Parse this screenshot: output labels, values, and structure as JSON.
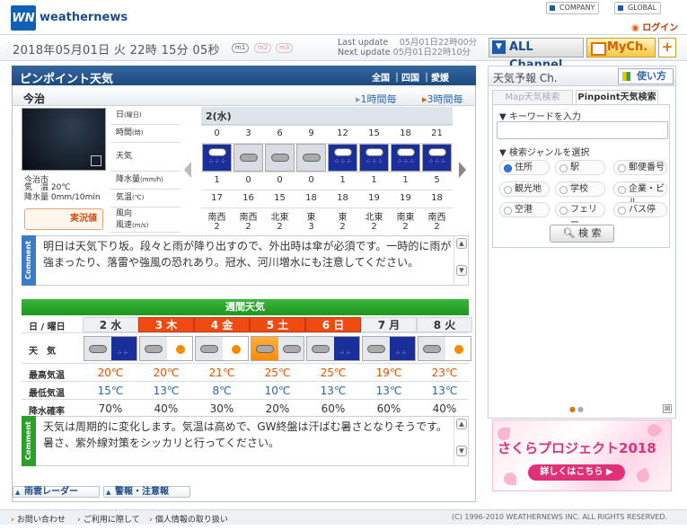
{
  "header": {
    "logo_text": "weathernews",
    "links": [
      "COMPANY",
      "GLOBAL"
    ],
    "login": "ログイン"
  },
  "datebar": {
    "clock": "2018年05月01日 火 22時 15分 05秒",
    "pills": [
      "m1",
      "m2",
      "m3"
    ],
    "last_update_label": "Last update",
    "last_update_value": "05月01日22時00分",
    "next_update_label": "Next update",
    "next_update_value": "05月01日22時10分",
    "all_channel": "ALL Channel",
    "mych": "MyCh.",
    "plus": "+"
  },
  "pinpoint": {
    "title": "ピンポイント天気",
    "breadcrumb": [
      "全国",
      "四国",
      "愛媛"
    ],
    "city": "今治",
    "tab_1h": "1時間毎",
    "tab_3h": "3時間毎",
    "camera": {
      "city": "今治市",
      "temp_label": "気　温",
      "temp_value": "20℃",
      "rain_label": "降水量",
      "rain_value": "0mm/10min",
      "live_label": "実況値"
    },
    "row_labels": {
      "date": "日",
      "date_sub": "(曜日)",
      "time": "時間",
      "time_sub": "(時)",
      "weather": "天気",
      "rain": "降水量",
      "rain_sub": "(mm/h)",
      "temp": "気温",
      "temp_sub": "(℃)",
      "wind": "風向",
      "wind_sub": "風速",
      "wind_unit": "(m/s)"
    },
    "date_header": "2(水)",
    "hours": [
      "0",
      "3",
      "6",
      "9",
      "12",
      "15",
      "18",
      "21"
    ],
    "weather": [
      "rain",
      "cloud",
      "cloud",
      "cloud",
      "rain",
      "rain",
      "rain",
      "rain"
    ],
    "rain": [
      "1",
      "0",
      "0",
      "0",
      "1",
      "1",
      "1",
      "5"
    ],
    "temp": [
      "17",
      "16",
      "15",
      "18",
      "18",
      "19",
      "19",
      "18"
    ],
    "wind_dir": [
      "南西",
      "南西",
      "北東",
      "東",
      "東",
      "北東",
      "南東",
      "南西"
    ],
    "wind_speed": [
      "2",
      "2",
      "2",
      "3",
      "2",
      "2",
      "2",
      "2"
    ],
    "comment_label": "Comment",
    "comment": "明日は天気下り坂。段々と雨が降り出すので、外出時は傘が必須です。一時的に雨が強まったり、落雷や強風の恐れあり。冠水、河川増水にも注意してください。"
  },
  "weekly": {
    "title": "週間天気",
    "labels": {
      "day": "日 / 曜日",
      "weather": "天　気",
      "max": "最高気温",
      "min": "最低気温",
      "pop": "降水確率"
    },
    "days": [
      {
        "day": "2 水",
        "holiday": false,
        "max": "20℃",
        "min": "15℃",
        "pop": "70%",
        "icon": "cloud-rain"
      },
      {
        "day": "3 木",
        "holiday": true,
        "max": "20℃",
        "min": "13℃",
        "pop": "40%",
        "icon": "cloud-sun"
      },
      {
        "day": "4 金",
        "holiday": true,
        "max": "21℃",
        "min": "8℃",
        "pop": "30%",
        "icon": "cloud-sun"
      },
      {
        "day": "5 土",
        "holiday": true,
        "max": "25℃",
        "min": "10℃",
        "pop": "20%",
        "icon": "sun-cloud"
      },
      {
        "day": "6 日",
        "holiday": true,
        "max": "25℃",
        "min": "13℃",
        "pop": "60%",
        "icon": "cloud-rain"
      },
      {
        "day": "7 月",
        "holiday": false,
        "max": "19℃",
        "min": "13℃",
        "pop": "60%",
        "icon": "cloud-rain"
      },
      {
        "day": "8 火",
        "holiday": false,
        "max": "23℃",
        "min": "13℃",
        "pop": "40%",
        "icon": "cloud-sun"
      }
    ],
    "comment_label": "Comment",
    "comment": "天気は周期的に変化します。気温は高めで、GW終盤は汗ばむ暑さとなりそうです。暑さ、紫外線対策をシッカリと行ってください。"
  },
  "bottom_links": [
    "雨雲レーダー",
    "警報・注意報"
  ],
  "footer": {
    "links": [
      "お問い合わせ",
      "ご利用に際して",
      "個人情報の取り扱い"
    ],
    "copyright": "(C) 1996-2010 WEATHERNEWS INC. ALL RIGHTS RESERVED."
  },
  "sidebar": {
    "title": "天気予報 Ch.",
    "howto": "使い方",
    "tabs": [
      "Map天気検索",
      "Pinpoint天気検索"
    ],
    "keyword_label": "▼ キーワードを入力",
    "genre_label": "▼ 検索ジャンルを選択",
    "genres": [
      "住所",
      "駅",
      "郵便番号",
      "観光地",
      "学校",
      "企業・ビル",
      "空港",
      "フェリー",
      "バス停"
    ],
    "search_button": "検 索",
    "banner_title": "さくらプロジェクト2018",
    "banner_button": "詳しくはこちら ▶"
  },
  "colors": {
    "header_blue": "#1c4a80",
    "holiday_red": "#ee4a12",
    "weekly_green": "#1f961f",
    "max_temp": "#e85000",
    "min_temp": "#2a66b0"
  }
}
